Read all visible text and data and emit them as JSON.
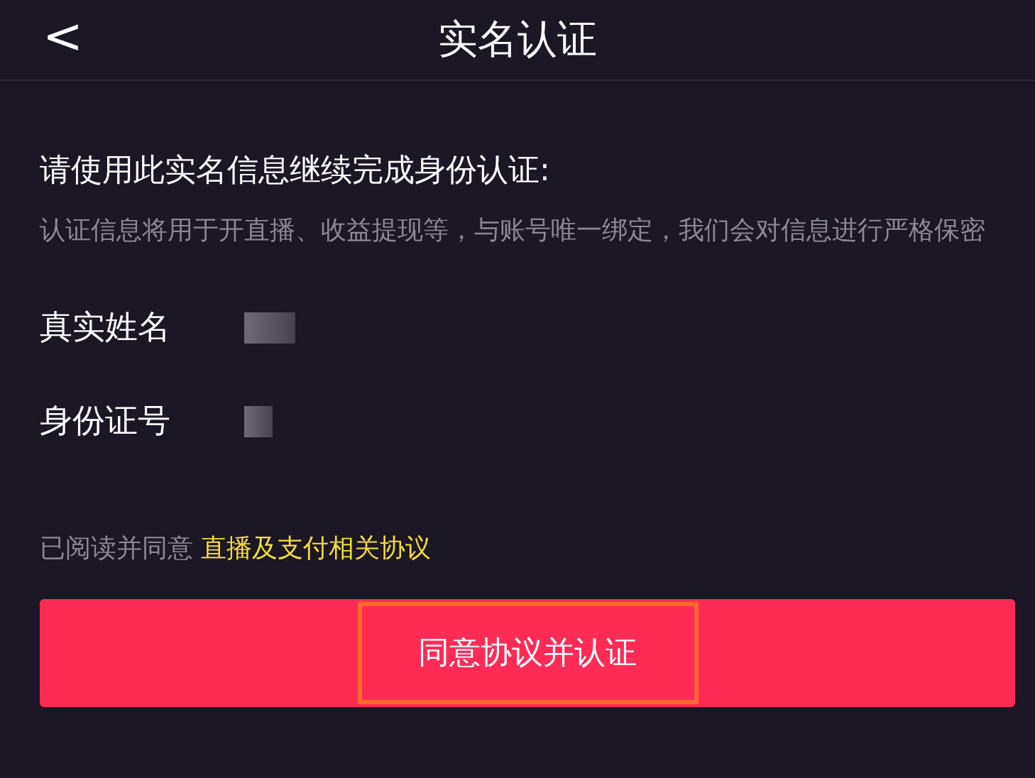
{
  "header": {
    "back_icon": "<",
    "title": "实名认证"
  },
  "intro": {
    "heading": "请使用此实名信息继续完成身份认证:",
    "note": "认证信息将用于开直播、收益提现等，与账号唯一绑定，我们会对信息进行严格保密"
  },
  "fields": [
    {
      "label": "真实姓名",
      "masked": true
    },
    {
      "label": "身份证号",
      "masked": true
    }
  ],
  "agreement": {
    "prefix": "已阅读并同意",
    "link": "直播及支付相关协议"
  },
  "submit_button": {
    "label": "同意协议并认证",
    "highlighted": true
  }
}
